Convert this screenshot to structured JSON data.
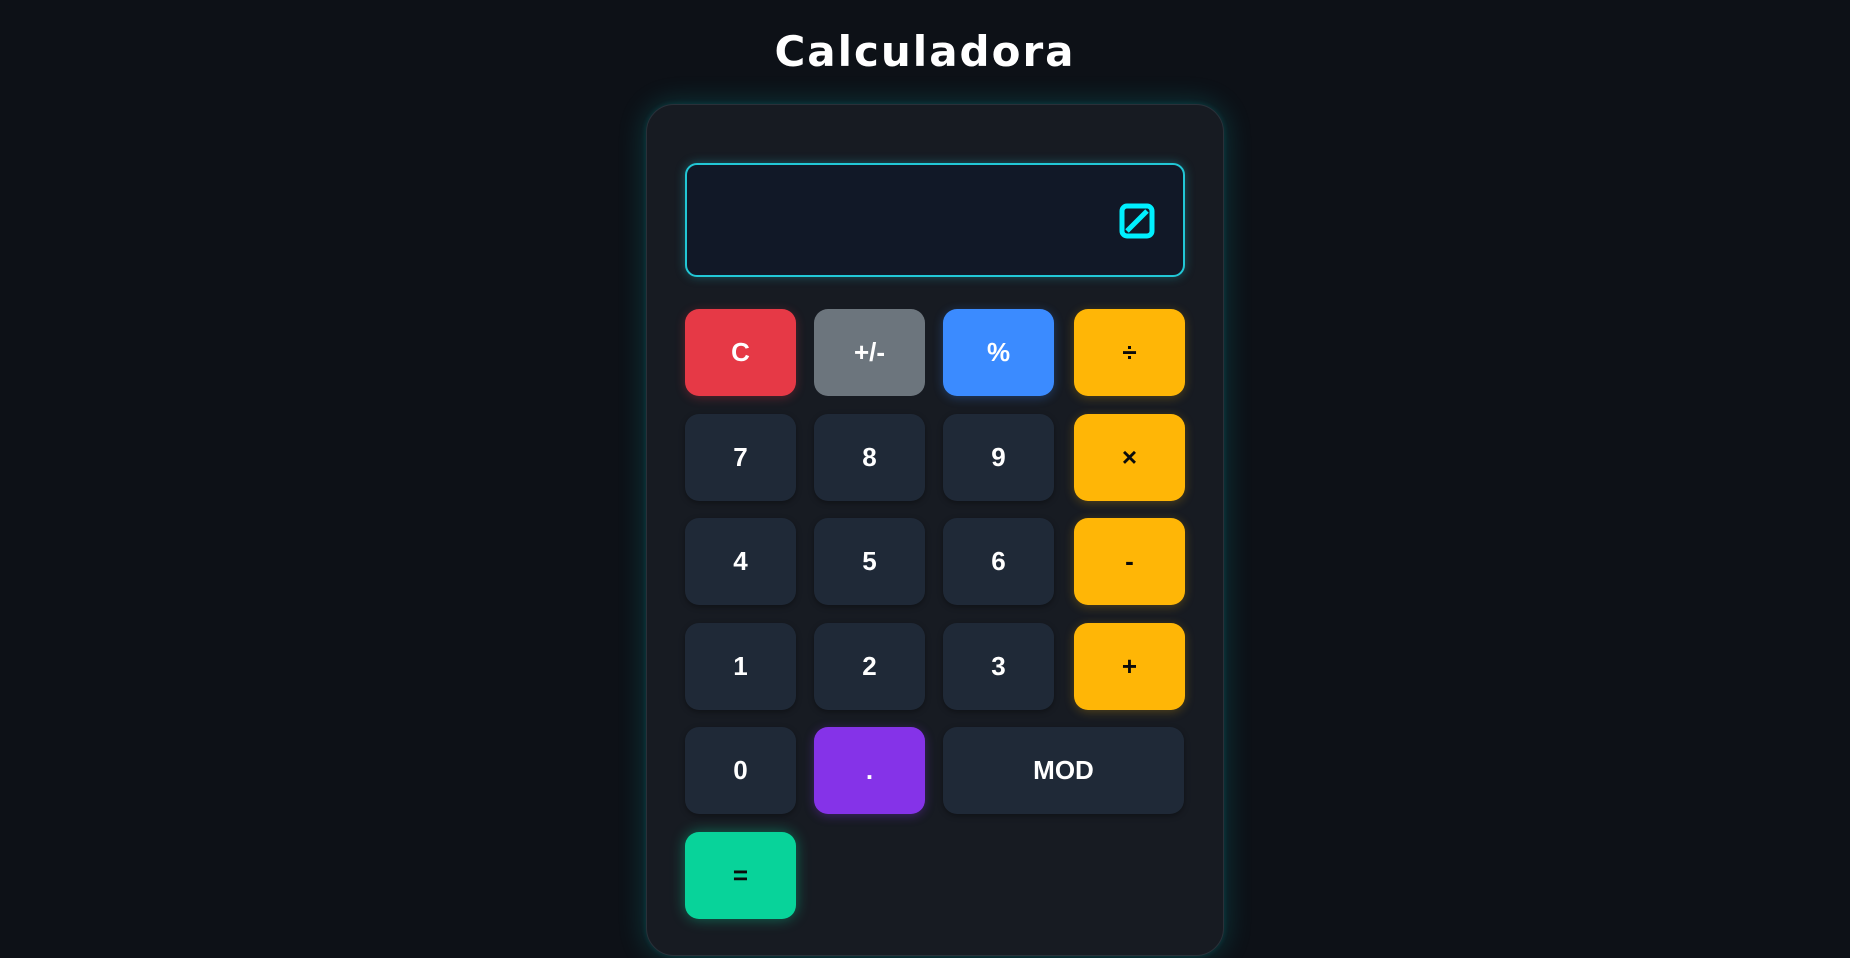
{
  "app": {
    "title": "Calculadora"
  },
  "display": {
    "value": "",
    "icon": "square-slash-icon",
    "accent_color": "#22c7d6"
  },
  "keypad": {
    "row1": [
      "C",
      "+/-",
      "%",
      "÷"
    ],
    "row2": [
      "7",
      "8",
      "9",
      "×"
    ],
    "row3": [
      "4",
      "5",
      "6",
      "-"
    ],
    "row4": [
      "1",
      "2",
      "3",
      "+"
    ],
    "row5": [
      "0",
      ".",
      "MOD"
    ],
    "row6": [
      "="
    ]
  },
  "colors": {
    "background": "#0d1117",
    "panel": "#171b22",
    "number_key": "#1f2937",
    "operator_key": "#ffb606",
    "clear_key": "#e63946",
    "sign_key": "#6c757d",
    "percent_key": "#3b8bff",
    "decimal_key": "#8533e8",
    "equals_key": "#08d39a"
  }
}
